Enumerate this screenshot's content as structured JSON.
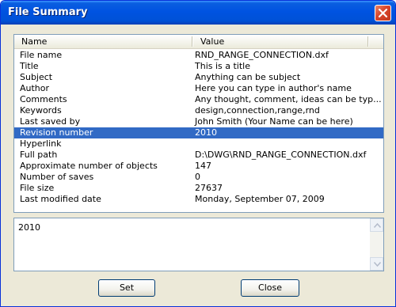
{
  "window": {
    "title": "File Summary"
  },
  "list": {
    "headers": {
      "name": "Name",
      "value": "Value"
    },
    "rows": [
      {
        "name": "File name",
        "value": "RND_RANGE_CONNECTION.dxf"
      },
      {
        "name": "Title",
        "value": "This is a title"
      },
      {
        "name": "Subject",
        "value": "Anything can be subject"
      },
      {
        "name": "Author",
        "value": "Here you can type in author's name"
      },
      {
        "name": "Comments",
        "value": "Any thought, comment, ideas can be typ..."
      },
      {
        "name": "Keywords",
        "value": "design,connection,range,rnd"
      },
      {
        "name": "Last saved by",
        "value": "John Smith (Your Name can be here)"
      },
      {
        "name": "Revision number",
        "value": "2010"
      },
      {
        "name": "Hyperlink",
        "value": ""
      },
      {
        "name": "Full path",
        "value": "D:\\DWG\\RND_RANGE_CONNECTION.dxf"
      },
      {
        "name": "Approximate number of objects",
        "value": "147"
      },
      {
        "name": "Number of saves",
        "value": "0"
      },
      {
        "name": "File size",
        "value": "27637"
      },
      {
        "name": "Last modified date",
        "value": "Monday, September 07, 2009"
      }
    ],
    "selected_row": "Revision number"
  },
  "editor": {
    "text": "2010"
  },
  "buttons": {
    "set": "Set",
    "close": "Close"
  },
  "icons": {
    "close": "close-x-icon",
    "scroll_up": "scroll-up-arrow-icon",
    "scroll_down": "scroll-down-arrow-icon"
  },
  "colors": {
    "title_bar": "#0054e3",
    "selection": "#316ac5",
    "close_button": "#d9442a",
    "dialog_face": "#ece9d8"
  }
}
